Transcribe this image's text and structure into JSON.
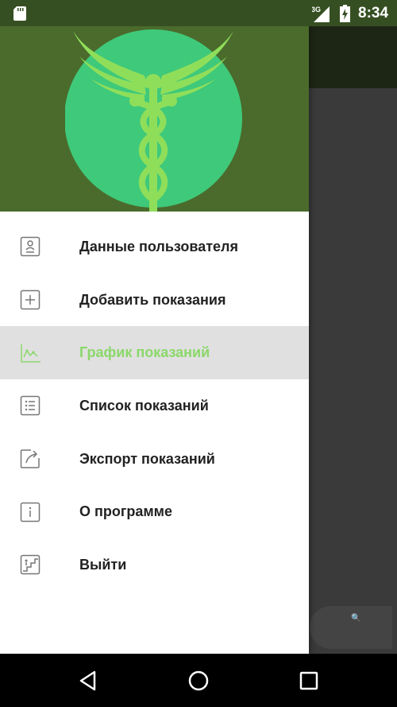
{
  "status_bar": {
    "time": "8:34",
    "network": "3G",
    "icons": [
      "sd-card-icon",
      "signal-icon",
      "battery-icon"
    ]
  },
  "drawer": {
    "header_logo": "caduceus-logo",
    "items": [
      {
        "label": "Данные пользователя",
        "icon": "user-card-icon",
        "active": false
      },
      {
        "label": "Добавить показания",
        "icon": "plus-box-icon",
        "active": false
      },
      {
        "label": "График показаний",
        "icon": "chart-icon",
        "active": true
      },
      {
        "label": "Список показаний",
        "icon": "list-icon",
        "active": false
      },
      {
        "label": "Экспорт показаний",
        "icon": "export-icon",
        "active": false
      },
      {
        "label": "О программе",
        "icon": "info-icon",
        "active": false
      },
      {
        "label": "Выйти",
        "icon": "exit-stairs-icon",
        "active": false
      }
    ]
  },
  "colors": {
    "header_green": "#4a6b2c",
    "status_green": "#364f22",
    "accent_green": "#8bd86a",
    "active_bg": "#e0e0e0"
  },
  "nav_bar": {
    "buttons": [
      "back-icon",
      "home-icon",
      "recents-icon"
    ]
  }
}
